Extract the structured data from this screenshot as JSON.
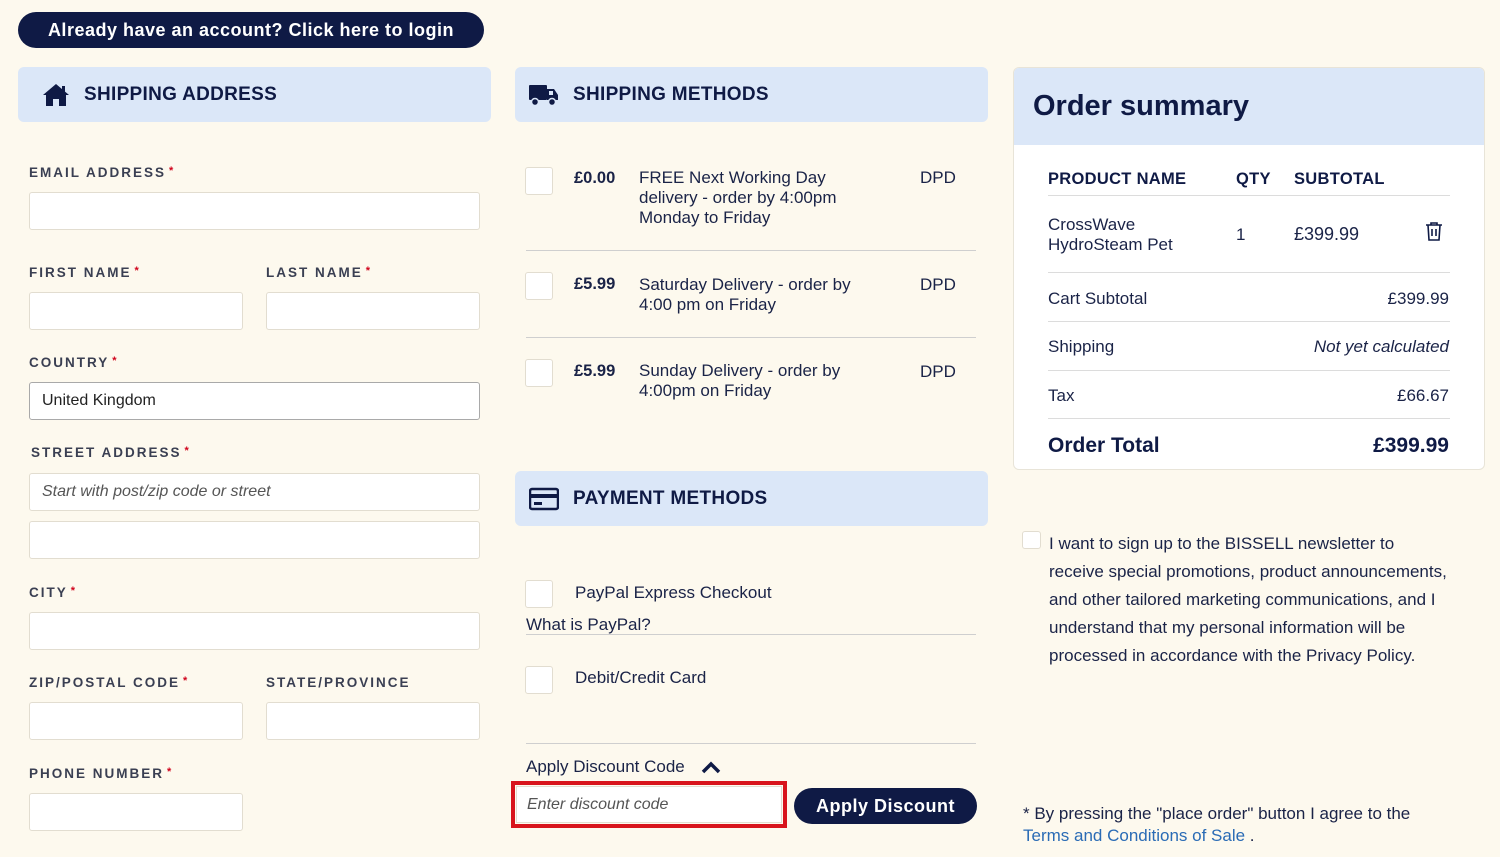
{
  "login_banner": "Already have an account? Click here to login",
  "shipping_address": {
    "header": "SHIPPING ADDRESS",
    "email_label": "EMAIL ADDRESS",
    "first_name_label": "FIRST NAME",
    "last_name_label": "LAST NAME",
    "country_label": "COUNTRY",
    "country_value": "United Kingdom",
    "street_label": "STREET ADDRESS",
    "street_placeholder": "Start with post/zip code or street",
    "city_label": "CITY",
    "zip_label": "ZIP/POSTAL CODE",
    "state_label": "STATE/PROVINCE",
    "phone_label": "PHONE NUMBER",
    "required_mark": "*"
  },
  "shipping_methods": {
    "header": "SHIPPING METHODS",
    "options": [
      {
        "price": "£0.00",
        "desc": "FREE Next Working Day delivery - order by 4:00pm Monday to Friday",
        "carrier": "DPD"
      },
      {
        "price": "£5.99",
        "desc": "Saturday Delivery - order by 4:00 pm on Friday",
        "carrier": "DPD"
      },
      {
        "price": "£5.99",
        "desc": "Sunday Delivery - order by 4:00pm on Friday",
        "carrier": "DPD"
      }
    ]
  },
  "payment_methods": {
    "header": "PAYMENT METHODS",
    "paypal_label": "PayPal Express Checkout",
    "paypal_link": "What is PayPal?",
    "card_label": "Debit/Credit Card"
  },
  "discount": {
    "toggle_label": "Apply Discount Code",
    "placeholder": "Enter discount code",
    "button_label": "Apply Discount"
  },
  "order_summary": {
    "title": "Order summary",
    "col_product": "PRODUCT NAME",
    "col_qty": "QTY",
    "col_subtotal": "SUBTOTAL",
    "item": {
      "name_line1": "CrossWave",
      "name_line2": "HydroSteam Pet",
      "qty": "1",
      "subtotal": "£399.99"
    },
    "cart_subtotal_label": "Cart Subtotal",
    "cart_subtotal_value": "£399.99",
    "shipping_label": "Shipping",
    "shipping_value": "Not yet calculated",
    "tax_label": "Tax",
    "tax_value": "£66.67",
    "total_label": "Order Total",
    "total_value": "£399.99"
  },
  "newsletter_text": "I want to sign up to the BISSELL newsletter to receive special promotions, product announcements, and other tailored marketing communications, and I understand that my personal information will be processed in accordance with the Privacy Policy.",
  "terms": {
    "prefix": "* By pressing the \"place order\" button I agree to the",
    "link": "Terms and Conditions of Sale",
    "suffix": " ."
  }
}
